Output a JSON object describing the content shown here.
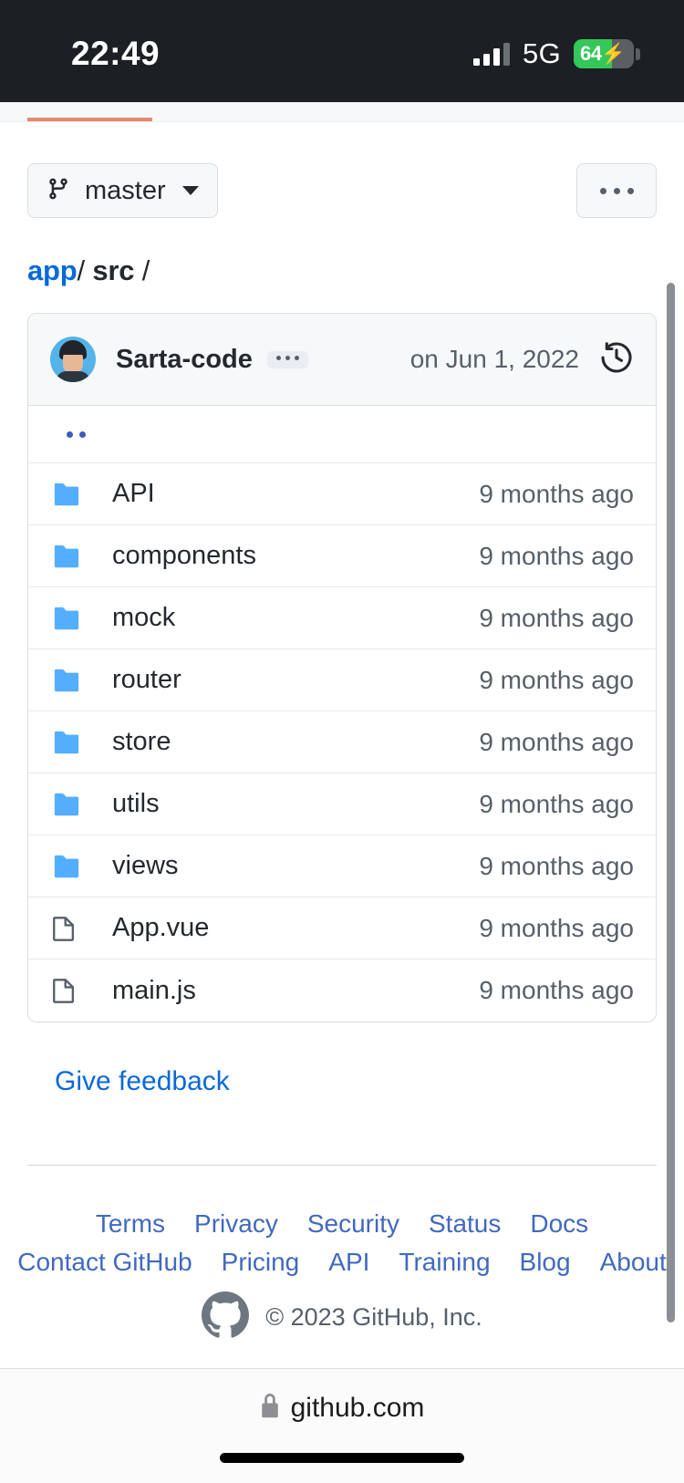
{
  "status_bar": {
    "time": "22:49",
    "network": "5G",
    "battery_percent": "64",
    "battery_level": 64,
    "charging_icon": "bolt-icon",
    "signal_icon": "cellular-signal-icon"
  },
  "toolbar": {
    "branch_name": "master",
    "branch_icon": "git-branch-icon",
    "branch_caret_icon": "chevron-down-icon",
    "more_options_icon": "kebab-horizontal-icon",
    "progress_color": "#e7876c"
  },
  "breadcrumb": {
    "root": "app",
    "separator": "/",
    "current": "src",
    "trailing": "/"
  },
  "commit": {
    "author": "Sarta-code",
    "avatar_icon": "user-avatar",
    "message_badge_icon": "ellipsis-icon",
    "date": "on Jun 1, 2022",
    "history_icon": "history-icon"
  },
  "files": {
    "parent_row_label": "..",
    "rows": [
      {
        "name": "API",
        "type": "folder",
        "icon": "folder-icon",
        "age": "9 months ago"
      },
      {
        "name": "components",
        "type": "folder",
        "icon": "folder-icon",
        "age": "9 months ago"
      },
      {
        "name": "mock",
        "type": "folder",
        "icon": "folder-icon",
        "age": "9 months ago"
      },
      {
        "name": "router",
        "type": "folder",
        "icon": "folder-icon",
        "age": "9 months ago"
      },
      {
        "name": "store",
        "type": "folder",
        "icon": "folder-icon",
        "age": "9 months ago"
      },
      {
        "name": "utils",
        "type": "folder",
        "icon": "folder-icon",
        "age": "9 months ago"
      },
      {
        "name": "views",
        "type": "folder",
        "icon": "folder-icon",
        "age": "9 months ago"
      },
      {
        "name": "App.vue",
        "type": "file",
        "icon": "file-icon",
        "age": "9 months ago"
      },
      {
        "name": "main.js",
        "type": "file",
        "icon": "file-icon",
        "age": "9 months ago"
      }
    ]
  },
  "feedback": {
    "label": "Give feedback"
  },
  "footer": {
    "row1": [
      "Terms",
      "Privacy",
      "Security",
      "Status",
      "Docs"
    ],
    "row2": [
      "Contact GitHub",
      "Pricing",
      "API",
      "Training",
      "Blog",
      "About"
    ],
    "logo_icon": "github-mark-icon",
    "copyright": "© 2023 GitHub, Inc."
  },
  "browser_bar": {
    "lock_icon": "lock-icon",
    "host": "github.com"
  },
  "colors": {
    "accent_link": "#0969da",
    "folder_blue": "#54aeff",
    "muted_text": "#57606a",
    "border": "#d8dee4",
    "battery_green": "#34c759"
  }
}
